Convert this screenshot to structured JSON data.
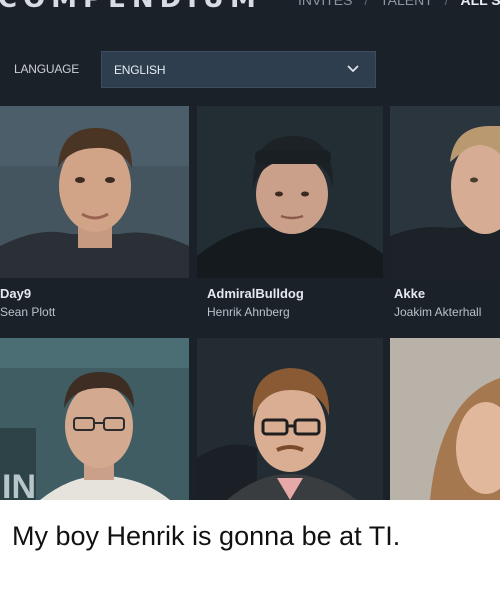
{
  "header": {
    "logo_text": "COMPENDIUM",
    "tabs": [
      {
        "label": "INVITES"
      },
      {
        "label": "TALENT"
      },
      {
        "label": "ALL S"
      }
    ],
    "separator": "/"
  },
  "language": {
    "label": "LANGUAGE",
    "selected": "ENGLISH"
  },
  "talent": [
    {
      "alias": "Day9",
      "name": "Sean Plott"
    },
    {
      "alias": "AdmiralBulldog",
      "name": "Henrik Ahnberg"
    },
    {
      "alias": "Akke",
      "name": "Joakim Akterhall"
    }
  ],
  "caption": "My boy Henrik is gonna be at TI.",
  "colors": {
    "background": "#1b2128",
    "select_bg": "#2e3e4f",
    "text_light": "#e4e9ee",
    "caption_text": "#111111"
  }
}
